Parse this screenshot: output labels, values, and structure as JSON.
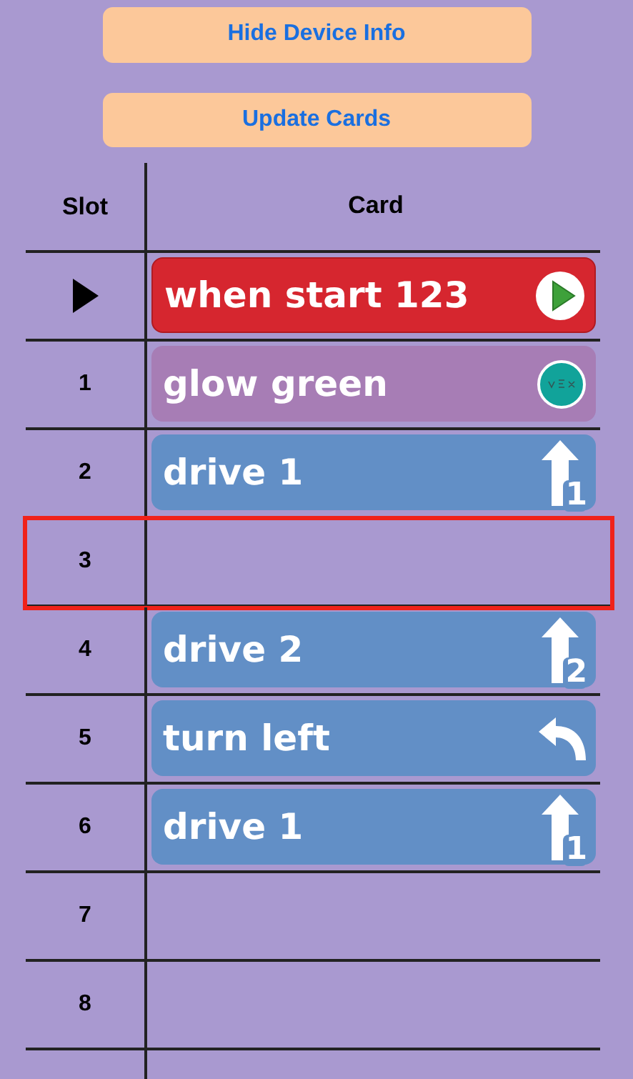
{
  "buttons": [
    {
      "label": "Hide Device Info"
    },
    {
      "label": "Update Cards"
    }
  ],
  "table": {
    "columns": [
      "Slot",
      "Card"
    ],
    "rows": [
      {
        "slot_marker": true,
        "selected": false,
        "card": {
          "kind": "start",
          "label": "when start 123"
        }
      },
      {
        "slot": "1",
        "selected": false,
        "card": {
          "kind": "looks",
          "label": "glow green"
        }
      },
      {
        "slot": "2",
        "selected": false,
        "card": {
          "kind": "drive",
          "label": "drive 1",
          "icon_number": "1"
        }
      },
      {
        "slot": "3",
        "selected": true
      },
      {
        "slot": "4",
        "selected": false,
        "card": {
          "kind": "drive",
          "label": "drive 2",
          "icon_number": "2"
        }
      },
      {
        "slot": "5",
        "selected": false,
        "card": {
          "kind": "turn",
          "label": "turn left"
        }
      },
      {
        "slot": "6",
        "selected": false,
        "card": {
          "kind": "drive",
          "label": "drive 1",
          "icon_number": "1"
        }
      },
      {
        "slot": "7",
        "selected": false
      },
      {
        "slot": "8",
        "selected": false
      }
    ]
  }
}
